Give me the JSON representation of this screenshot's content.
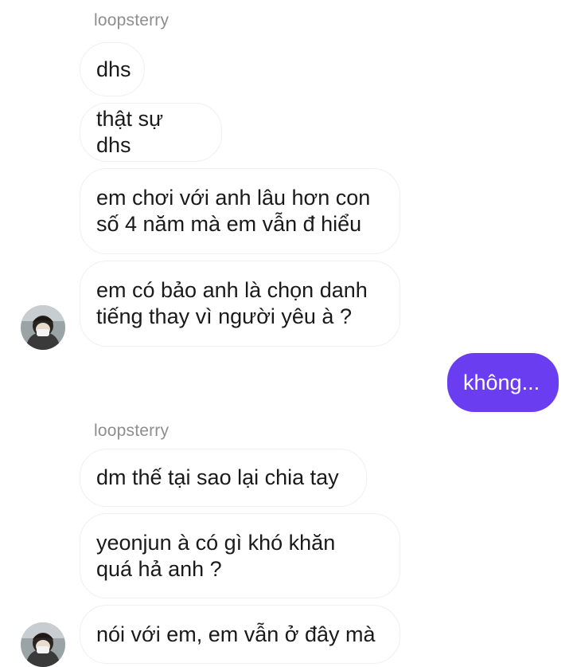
{
  "thread": {
    "sender_1": "loopsterry",
    "sender_2": "loopsterry",
    "messages": [
      {
        "from": "them",
        "text": "dhs"
      },
      {
        "from": "them",
        "text": "thật sự dhs"
      },
      {
        "from": "them",
        "text": "em chơi với anh lâu hơn con\nsố 4 năm mà em vẫn đ hiểu"
      },
      {
        "from": "them",
        "text": "em có bảo anh là chọn danh\ntiếng thay vì người yêu à ?"
      },
      {
        "from": "me",
        "text": "không..."
      },
      {
        "from": "them",
        "text": "dm thế tại sao lại chia tay"
      },
      {
        "from": "them",
        "text": "yeonjun à có gì khó khăn\nquá hả anh ?"
      },
      {
        "from": "them",
        "text": "nói với em, em vẫn ở đây mà"
      }
    ]
  },
  "colors": {
    "me_bubble": "#6a3df0",
    "them_bubble_border": "#efefef",
    "sender_name": "#8e8e8e"
  }
}
